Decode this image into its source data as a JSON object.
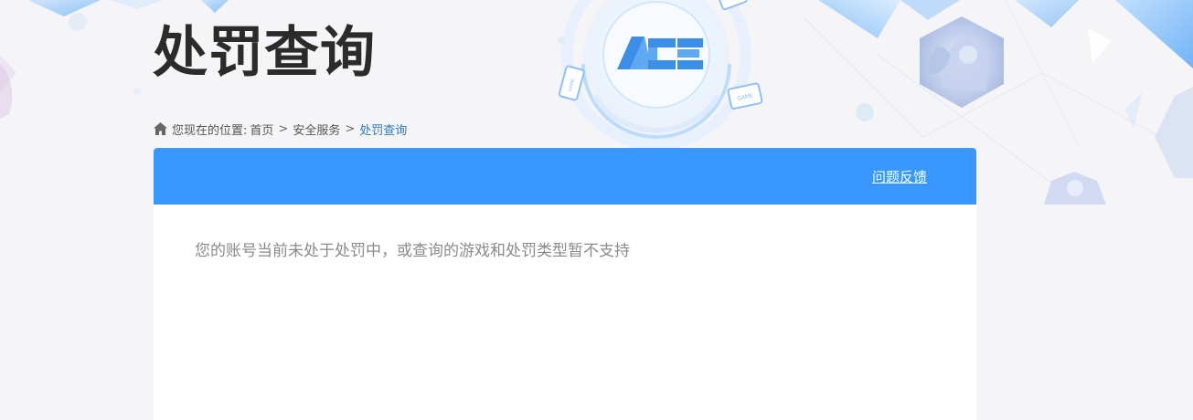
{
  "header": {
    "title": "处罚查询"
  },
  "breadcrumb": {
    "prefix": "您现在的位置:",
    "separator": ">",
    "items": [
      {
        "label": "首页"
      },
      {
        "label": "安全服务"
      },
      {
        "label": "处罚查询"
      }
    ]
  },
  "panel": {
    "feedback_label": "问题反馈",
    "message": "您的账号当前未处于处罚中，或查询的游戏和处罚类型暂不支持",
    "header_color": "#3898ff"
  },
  "decor": {
    "logo_text": "ACE",
    "device_label": "GAME"
  },
  "icons": [
    "home-icon",
    "ace-logo",
    "game-phone-icon",
    "game-tablet-icon"
  ]
}
